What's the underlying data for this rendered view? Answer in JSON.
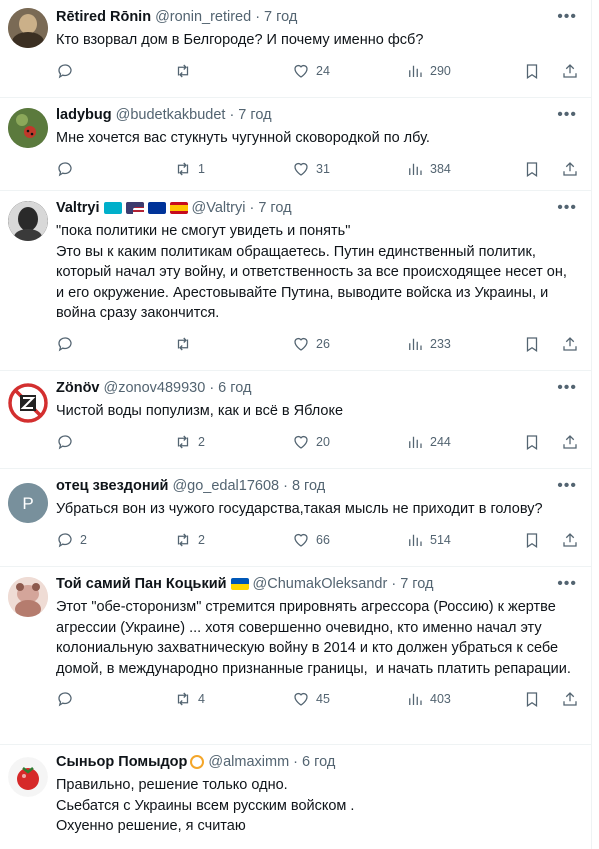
{
  "tweets": [
    {
      "name": "Rētired Rōnin",
      "handle": "@ronin_retired",
      "time": "7 год",
      "text": "Кто взорвал дом в Белгороде? И почему именно фсб?",
      "replies": "",
      "retweets": "",
      "likes": "24",
      "views": "290"
    },
    {
      "name": "ladybug",
      "handle": "@budetkakbudet",
      "time": "7 год",
      "text": "Мне хочется вас стукнуть чугунной сковородкой по лбу.",
      "replies": "",
      "retweets": "1",
      "likes": "31",
      "views": "384"
    },
    {
      "name": "Valtryi",
      "handle": "@Valtryi",
      "time": "7 год",
      "text": "\"пока политики не смогут увидеть и понять\"\nЭто вы к каким политикам обращаетесь. Путин единственный политик, который начал эту войну, и ответственность за все происходящее несет он, и его окружение. Арестовывайте Путина, выводите войска из Украины, и война сразу закончится.",
      "replies": "",
      "retweets": "",
      "likes": "26",
      "views": "233"
    },
    {
      "name": "Zönöv",
      "handle": "@zonov489930",
      "time": "6 год",
      "text": "Чистой воды популизм, как и всё в Яблоке",
      "replies": "",
      "retweets": "2",
      "likes": "20",
      "views": "244"
    },
    {
      "name": "отец звездоний",
      "handle": "@go_edal17608",
      "time": "8 год",
      "text": "Убраться вон из чужого государства,такая мысль не приходит в голову?",
      "replies": "2",
      "retweets": "2",
      "likes": "66",
      "views": "514"
    },
    {
      "name": "Той самий Пан Коцький",
      "handle": "@ChumakOleksandr",
      "time": "7 год",
      "text": "Этот \"обе-сторонизм\" стремится приро­внять агрессора (Россию) к жертве агрессии (Украине) ... хотя совершенно очевидно, кто именно начал эту колониальную захватническую войну в 2014 и кто должен убраться к себе домой, в международно признанные границы,  и начать платить репарации.",
      "replies": "",
      "retweets": "4",
      "likes": "45",
      "views": "403"
    },
    {
      "name": "Сыньор Помыдор",
      "handle": "@almaximm",
      "time": "6 год",
      "text": "Правильно, решение только одно.\nСьебатся с Украины всем русским войском .\nОхуенно решение, я считаю",
      "replies": "",
      "retweets": "",
      "likes": "",
      "views": ""
    }
  ],
  "icons": {
    "reply": "reply-icon",
    "retweet": "retweet-icon",
    "like": "heart-icon",
    "views": "views-icon",
    "bookmark": "bookmark-icon",
    "share": "share-icon",
    "more": "more-icon"
  },
  "colors": {
    "muted": "#536471",
    "text": "#0f1419",
    "divider": "#eff3f4"
  }
}
